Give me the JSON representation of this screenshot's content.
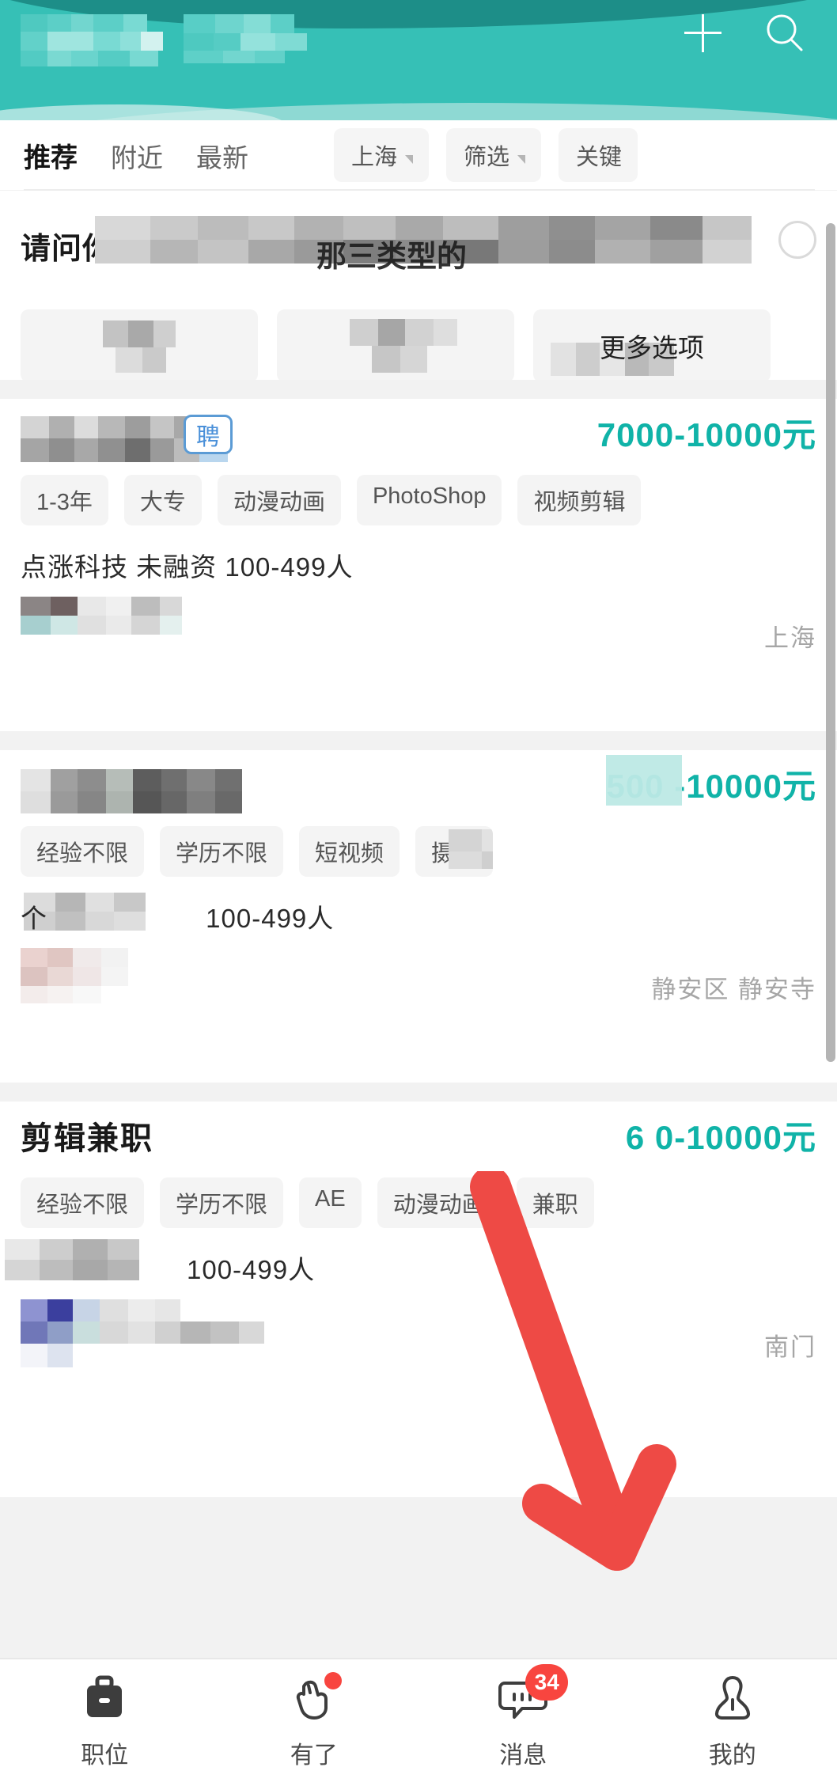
{
  "theme": {
    "brand_teal": "#36c0b6",
    "salary_teal": "#10b3a8",
    "badge_red": "#f8453f",
    "annotation_red": "#ee4a45",
    "chip_grey": "#f4f4f4"
  },
  "header": {
    "title_redacted": "",
    "subtitle_redacted": "",
    "add_icon": "plus-icon",
    "search_icon": "search-icon"
  },
  "tabs": [
    {
      "label": "推荐",
      "active": true
    },
    {
      "label": "附近",
      "active": false
    },
    {
      "label": "最新",
      "active": false
    }
  ],
  "filter_chips": [
    {
      "label": "上海",
      "has_caret": true
    },
    {
      "label": "筛选",
      "has_caret": true
    },
    {
      "label": "关键",
      "has_caret": false
    }
  ],
  "survey": {
    "question_visible": "请问你",
    "question_fragment": "那三类型的",
    "close_icon": "close-circle-icon",
    "options": [
      {
        "label": ""
      },
      {
        "label": ""
      },
      {
        "label": "更多选项"
      }
    ]
  },
  "jobs": [
    {
      "title": "",
      "title_redacted": true,
      "badge": "聘",
      "salary": "7000-10000元",
      "tags": [
        "1-3年",
        "大专",
        "动漫动画",
        "PhotoShop",
        "视频剪辑"
      ],
      "company": "点涨科技 未融资 100-499人",
      "location": "上海"
    },
    {
      "title": "",
      "title_redacted": true,
      "badge": "",
      "salary": "500 -10000元",
      "tags": [
        "经验不限",
        "学历不限",
        "短视频",
        "摄影"
      ],
      "company": "100-499人",
      "location": "静安区 静安寺"
    },
    {
      "title": "剪辑兼职",
      "title_redacted": false,
      "badge": "",
      "salary": "6 0-10000元",
      "tags": [
        "经验不限",
        "学历不限",
        "AE",
        "动漫动画",
        "兼职"
      ],
      "company": "100-499人",
      "location": "南门"
    }
  ],
  "bottom_nav": [
    {
      "label": "职位",
      "icon": "briefcase-icon",
      "active": true,
      "dot": false,
      "count": ""
    },
    {
      "label": "有了",
      "icon": "hand-tap-icon",
      "active": false,
      "dot": true,
      "count": ""
    },
    {
      "label": "消息",
      "icon": "chat-bubble-icon",
      "active": false,
      "dot": false,
      "count": "34"
    },
    {
      "label": "我的",
      "icon": "person-icon",
      "active": false,
      "dot": false,
      "count": ""
    }
  ],
  "annotation": {
    "type": "red-arrow",
    "points_to": "我的"
  }
}
